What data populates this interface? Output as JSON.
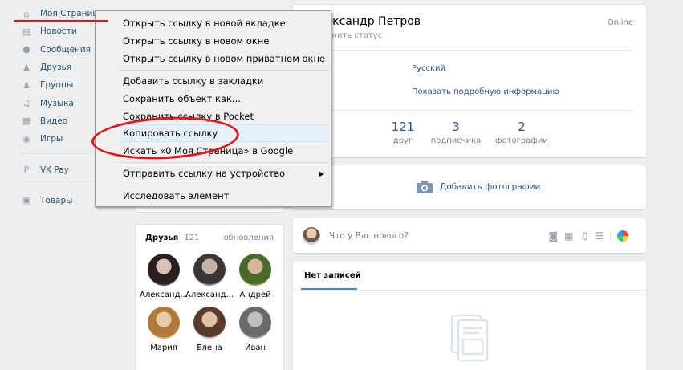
{
  "nav": [
    {
      "label": "Моя Страница",
      "icon": "home-icon",
      "glyph": "⌂"
    },
    {
      "label": "Новости",
      "icon": "news-icon",
      "glyph": "▤"
    },
    {
      "label": "Сообщения",
      "icon": "messages-icon",
      "glyph": "●"
    },
    {
      "label": "Друзья",
      "icon": "friends-icon",
      "glyph": "♟"
    },
    {
      "label": "Группы",
      "icon": "groups-icon",
      "glyph": "♟"
    },
    {
      "label": "Музыка",
      "icon": "music-icon",
      "glyph": "♫"
    },
    {
      "label": "Видео",
      "icon": "video-icon",
      "glyph": "▦"
    },
    {
      "label": "Игры",
      "icon": "games-icon",
      "glyph": "◉"
    }
  ],
  "nav2": [
    {
      "label": "VK Pay",
      "icon": "vkpay-icon",
      "glyph": "P"
    }
  ],
  "nav3": [
    {
      "label": "Товары",
      "icon": "goods-icon",
      "glyph": "▣"
    }
  ],
  "menu": {
    "items": [
      "Открыть ссылку в новой вкладке",
      "Открыть ссылку в новом окне",
      "Открыть ссылку в новом приватном окне",
      "Добавить ссылку в закладки",
      "Сохранить объект как...",
      "Сохранить ссылку в Pocket",
      "Копировать ссылку",
      "Искать «0 Моя Страница» в Google",
      "Отправить ссылку на устройство",
      "Исследовать элемент"
    ]
  },
  "profile": {
    "name": "Александр Петров",
    "status_placeholder": "Изменить статус",
    "online": "Online",
    "language": "Русский",
    "more_info": "Показать подробную информацию",
    "counters": [
      {
        "value": "121",
        "label": "друг"
      },
      {
        "value": "3",
        "label": "подписчика"
      },
      {
        "value": "2",
        "label": "фотографии"
      }
    ]
  },
  "photos": {
    "add_label": "Добавить фотографии"
  },
  "post": {
    "placeholder": "Что у Вас нового?"
  },
  "wall": {
    "tab": "Нет записей"
  },
  "friends": {
    "title": "Друзья",
    "count": "121",
    "updates": "обновления",
    "list": [
      "Александ...",
      "Александ...",
      "Андрей",
      "Мария",
      "Елена",
      "Иван"
    ]
  },
  "colors": {
    "accent": "#2a5885",
    "annotation_red": "#e4161b",
    "page_bg": "#edeef0"
  }
}
